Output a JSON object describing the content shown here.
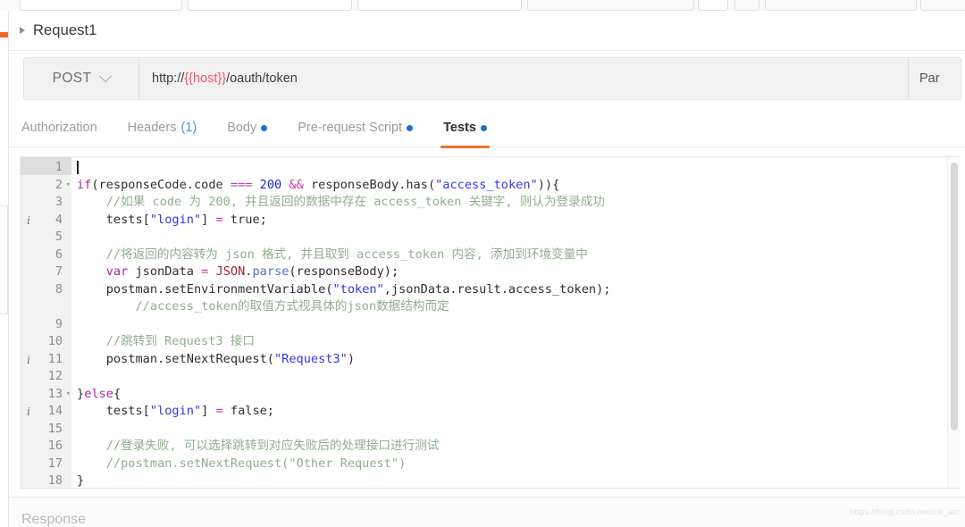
{
  "window": {
    "request_title": "Request1",
    "collapse_icon": "triangle-right-icon"
  },
  "url_bar": {
    "method": "POST",
    "method_chevron_icon": "chevron-down-icon",
    "url_prefix": "http://",
    "url_variable": "{{host}}",
    "url_suffix": "/oauth/token",
    "params_label": "Par"
  },
  "tabs": [
    {
      "label": "Authorization",
      "badge": "",
      "dot": false,
      "active": false
    },
    {
      "label": "Headers",
      "badge": "(1)",
      "dot": false,
      "active": false
    },
    {
      "label": "Body",
      "badge": "",
      "dot": true,
      "active": false
    },
    {
      "label": "Pre-request Script",
      "badge": "",
      "dot": true,
      "active": false
    },
    {
      "label": "Tests",
      "badge": "",
      "dot": true,
      "active": true
    }
  ],
  "editor": {
    "active_line": 1,
    "lines": [
      {
        "num": "1",
        "fold": false,
        "info": false,
        "text": ""
      },
      {
        "num": "2",
        "fold": true,
        "info": false,
        "tokens": [
          {
            "t": "if",
            "c": "k-kw"
          },
          {
            "t": "(",
            "c": ""
          },
          {
            "t": "responseCode",
            "c": ""
          },
          {
            "t": ".",
            "c": ""
          },
          {
            "t": "code",
            "c": ""
          },
          {
            "t": " ",
            "c": ""
          },
          {
            "t": "===",
            "c": "k-op"
          },
          {
            "t": " ",
            "c": ""
          },
          {
            "t": "200",
            "c": "k-num"
          },
          {
            "t": " ",
            "c": ""
          },
          {
            "t": "&&",
            "c": "k-op"
          },
          {
            "t": " ",
            "c": ""
          },
          {
            "t": "responseBody",
            "c": ""
          },
          {
            "t": ".",
            "c": ""
          },
          {
            "t": "has",
            "c": ""
          },
          {
            "t": "(",
            "c": ""
          },
          {
            "t": "\"access_token\"",
            "c": "k-str"
          },
          {
            "t": ")){",
            "c": ""
          }
        ]
      },
      {
        "num": "3",
        "fold": false,
        "info": false,
        "tokens": [
          {
            "t": "    //如果 code 为 200, 并且返回的数据中存在 access_token 关键字, 则认为登录成功",
            "c": "k-cmt"
          }
        ]
      },
      {
        "num": "4",
        "fold": false,
        "info": true,
        "tokens": [
          {
            "t": "    tests[",
            "c": ""
          },
          {
            "t": "\"login\"",
            "c": "k-str"
          },
          {
            "t": "] ",
            "c": ""
          },
          {
            "t": "=",
            "c": "k-op"
          },
          {
            "t": " true;",
            "c": ""
          }
        ]
      },
      {
        "num": "5",
        "fold": false,
        "info": false,
        "tokens": []
      },
      {
        "num": "6",
        "fold": false,
        "info": false,
        "tokens": [
          {
            "t": "    //将返回的内容转为 json 格式, 并且取到 access_token 内容, 添加到环境变量中",
            "c": "k-cmt"
          }
        ]
      },
      {
        "num": "7",
        "fold": false,
        "info": false,
        "tokens": [
          {
            "t": "    ",
            "c": ""
          },
          {
            "t": "var",
            "c": "k-kw"
          },
          {
            "t": " jsonData ",
            "c": ""
          },
          {
            "t": "=",
            "c": "k-op"
          },
          {
            "t": " ",
            "c": ""
          },
          {
            "t": "JSON",
            "c": "k-cls"
          },
          {
            "t": ".",
            "c": ""
          },
          {
            "t": "parse",
            "c": "k-fn"
          },
          {
            "t": "(responseBody);",
            "c": ""
          }
        ]
      },
      {
        "num": "8",
        "fold": false,
        "info": false,
        "tokens": [
          {
            "t": "    postman.setEnvironmentVariable(",
            "c": ""
          },
          {
            "t": "\"token\"",
            "c": "k-str"
          },
          {
            "t": ",jsonData.result.access_token);",
            "c": ""
          }
        ]
      },
      {
        "num": "8b",
        "fold": false,
        "info": false,
        "hidenum": true,
        "tokens": [
          {
            "t": "        //access_token的取值方式视具体的json数据结构而定",
            "c": "k-cmt"
          }
        ]
      },
      {
        "num": "9",
        "fold": false,
        "info": false,
        "tokens": []
      },
      {
        "num": "10",
        "fold": false,
        "info": false,
        "tokens": [
          {
            "t": "    //跳转到 Request3 接口",
            "c": "k-cmt"
          }
        ]
      },
      {
        "num": "11",
        "fold": false,
        "info": true,
        "tokens": [
          {
            "t": "    postman.setNextRequest(",
            "c": ""
          },
          {
            "t": "\"Request3\"",
            "c": "k-str"
          },
          {
            "t": ")",
            "c": ""
          }
        ]
      },
      {
        "num": "12",
        "fold": false,
        "info": false,
        "tokens": []
      },
      {
        "num": "13",
        "fold": true,
        "info": false,
        "tokens": [
          {
            "t": "}",
            "c": ""
          },
          {
            "t": "else",
            "c": "k-kw"
          },
          {
            "t": "{",
            "c": ""
          }
        ]
      },
      {
        "num": "14",
        "fold": false,
        "info": true,
        "tokens": [
          {
            "t": "    tests[",
            "c": ""
          },
          {
            "t": "\"login\"",
            "c": "k-str"
          },
          {
            "t": "] ",
            "c": ""
          },
          {
            "t": "=",
            "c": "k-op"
          },
          {
            "t": " false;",
            "c": ""
          }
        ]
      },
      {
        "num": "15",
        "fold": false,
        "info": false,
        "tokens": []
      },
      {
        "num": "16",
        "fold": false,
        "info": false,
        "tokens": [
          {
            "t": "    //登录失败, 可以选择跳转到对应失败后的处理接口进行测试",
            "c": "k-cmt"
          }
        ]
      },
      {
        "num": "17",
        "fold": false,
        "info": false,
        "tokens": [
          {
            "t": "    //postman.setNextRequest(\"Other Request\")",
            "c": "k-cmt"
          }
        ]
      },
      {
        "num": "18",
        "fold": false,
        "info": false,
        "tokens": [
          {
            "t": "}",
            "c": ""
          }
        ]
      }
    ]
  },
  "bottom": {
    "response_label": "Response",
    "watermark": "https://blog.csdn.net/cai_iac"
  },
  "colors": {
    "accent_orange": "#f0712a",
    "dot_blue": "#1a73c4",
    "variable_red": "#f0566e",
    "active_line": "#e8f2fb"
  }
}
